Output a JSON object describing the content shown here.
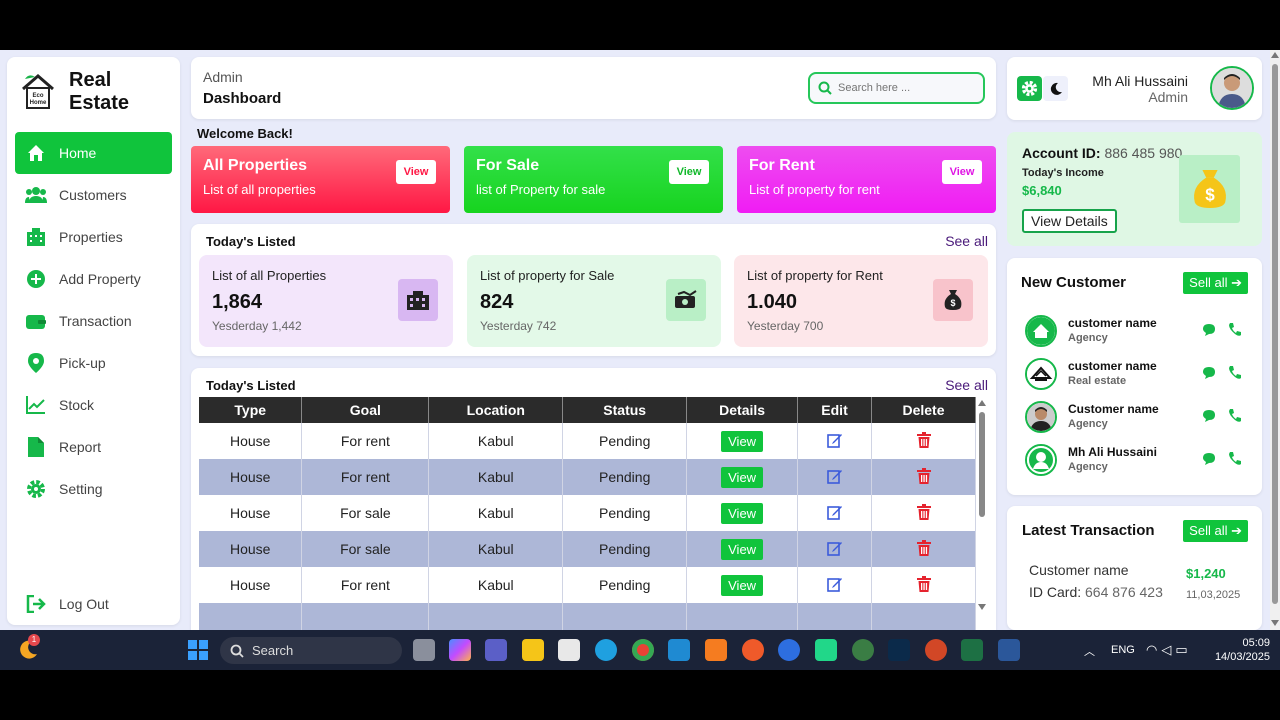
{
  "app": {
    "logo_small": "Eco Home",
    "logo_line1": "Real",
    "logo_line2": "Estate"
  },
  "sidebar": {
    "items": [
      {
        "label": "Home",
        "icon": "home-icon",
        "active": true
      },
      {
        "label": "Customers",
        "icon": "users-icon"
      },
      {
        "label": "Properties",
        "icon": "building-icon"
      },
      {
        "label": "Add Property",
        "icon": "plus-circle-icon"
      },
      {
        "label": "Transaction",
        "icon": "wallet-icon"
      },
      {
        "label": "Pick-up",
        "icon": "location-pin-icon"
      },
      {
        "label": "Stock",
        "icon": "chart-line-icon"
      },
      {
        "label": "Report",
        "icon": "file-icon"
      },
      {
        "label": "Setting",
        "icon": "gear-icon"
      }
    ],
    "logout": "Log Out"
  },
  "header": {
    "crumb": "Admin",
    "title": "Dashboard",
    "search_placeholder": "Search here ..."
  },
  "welcome": "Welcome Back!",
  "summary_cards": [
    {
      "title": "All Properties",
      "subtitle": "List of all properties",
      "button": "View",
      "color_from": "#ff6a7a",
      "color_to": "#ff1744"
    },
    {
      "title": "For Sale",
      "subtitle": "list of Property for sale",
      "button": "View",
      "color_from": "#33e04a",
      "color_to": "#17d41f"
    },
    {
      "title": "For Rent",
      "subtitle": "List of property for rent",
      "button": "View",
      "color_from": "#ee4df0",
      "color_to": "#f01cf4"
    }
  ],
  "todays_listed": {
    "heading": "Today's Listed",
    "see_all": "See all",
    "stats": [
      {
        "label": "List of all Properties",
        "value": "1,864",
        "yesterday": "Yesderday 1,442",
        "bg": "#f3e6fb",
        "icon_bg": "#d8b7f2",
        "icon": "building-icon"
      },
      {
        "label": "List of property for Sale",
        "value": "824",
        "yesterday": "Yesterday 742",
        "bg": "#e3f9e8",
        "icon_bg": "#b9efc6",
        "icon": "money-icon"
      },
      {
        "label": "List of property for Rent",
        "value": "1.040",
        "yesterday": "Yesterday 700",
        "bg": "#fde7ea",
        "icon_bg": "#f8c3cb",
        "icon": "money-bag-icon"
      }
    ]
  },
  "table": {
    "heading": "Today's Listed",
    "see_all": "See all",
    "columns": [
      "Type",
      "Goal",
      "Location",
      "Status",
      "Details",
      "Edit",
      "Delete"
    ],
    "rows": [
      {
        "type": "House",
        "goal": "For rent",
        "location": "Kabul",
        "status": "Pending",
        "details": "View"
      },
      {
        "type": "House",
        "goal": "For rent",
        "location": "Kabul",
        "status": "Pending",
        "details": "View"
      },
      {
        "type": "House",
        "goal": "For sale",
        "location": "Kabul",
        "status": "Pending",
        "details": "View"
      },
      {
        "type": "House",
        "goal": "For sale",
        "location": "Kabul",
        "status": "Pending",
        "details": "View"
      },
      {
        "type": "House",
        "goal": "For rent",
        "location": "Kabul",
        "status": "Pending",
        "details": "View"
      }
    ]
  },
  "profile": {
    "name": "Mh Ali Hussaini",
    "role": "Admin"
  },
  "account": {
    "label": "Account ID:",
    "id": "886 485 980",
    "income_label": "Today's Income",
    "income": "$6,840",
    "button": "View Details"
  },
  "new_customer": {
    "heading": "New Customer",
    "button": "Sell all",
    "items": [
      {
        "name": "customer name",
        "role": "Agency"
      },
      {
        "name": "customer name",
        "role": "Real estate"
      },
      {
        "name": "Customer name",
        "role": "Agency"
      },
      {
        "name": "Mh Ali Hussaini",
        "role": "Agency"
      }
    ]
  },
  "latest_transaction": {
    "heading": "Latest Transaction",
    "button": "Sell all",
    "name": "Customer name",
    "id_label": "ID Card:",
    "id": "664 876 423",
    "amount": "$1,240",
    "date": "11,03,2025"
  },
  "taskbar": {
    "search": "Search",
    "lang": "ENG",
    "time": "05:09",
    "date": "14/03/2025",
    "badge": "1"
  }
}
